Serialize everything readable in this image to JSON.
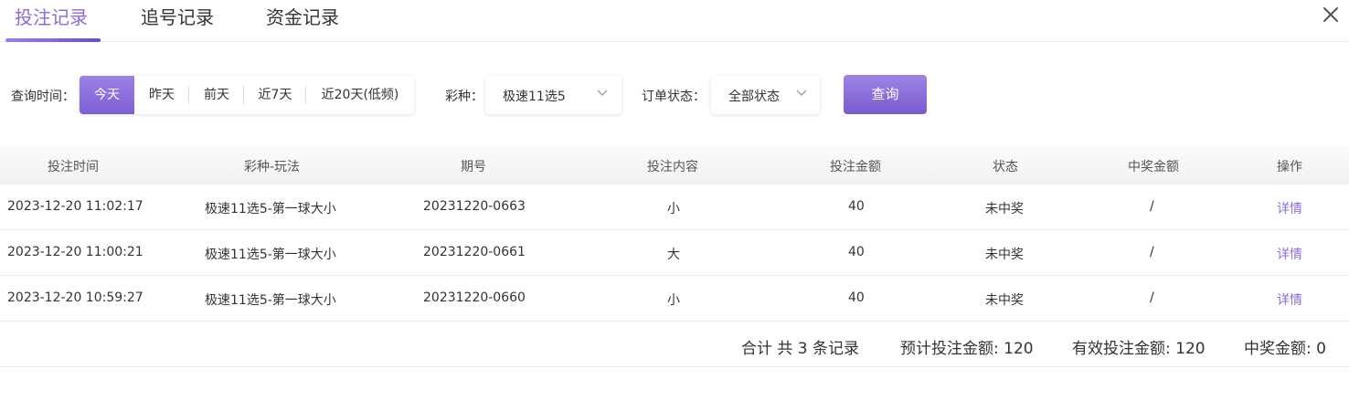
{
  "tabs": [
    {
      "label": "投注记录",
      "active": true
    },
    {
      "label": "追号记录",
      "active": false
    },
    {
      "label": "资金记录",
      "active": false
    }
  ],
  "filters": {
    "time_label": "查询时间：",
    "date_options": [
      "今天",
      "昨天",
      "前天",
      "近7天",
      "近20天(低频)"
    ],
    "date_selected": "今天",
    "lottery_label": "彩种：",
    "lottery_value": "极速11选5",
    "status_label": "订单状态：",
    "status_value": "全部状态",
    "query_button": "查询"
  },
  "table": {
    "headers": [
      "投注时间",
      "彩种-玩法",
      "期号",
      "投注内容",
      "投注金额",
      "状态",
      "中奖金额",
      "操作"
    ],
    "rows": [
      [
        "2023-12-20 11:02:17",
        "极速11选5-第一球大小",
        "20231220-0663",
        "小",
        "40",
        "未中奖",
        "/",
        "详情"
      ],
      [
        "2023-12-20 11:00:21",
        "极速11选5-第一球大小",
        "20231220-0661",
        "大",
        "40",
        "未中奖",
        "/",
        "详情"
      ],
      [
        "2023-12-20 10:59:27",
        "极速11选5-第一球大小",
        "20231220-0660",
        "小",
        "40",
        "未中奖",
        "/",
        "详情"
      ]
    ]
  },
  "summary": {
    "total": "合计 共 3 条记录",
    "expected_bet": "预计投注金额: 120",
    "valid_bet": "有效投注金额: 120",
    "win_amount": "中奖金额: 0"
  },
  "icons": {
    "close": "close-icon",
    "dropdown": "chevron-down-icon"
  },
  "colors": {
    "accent": "#8b6bd9",
    "accent_dark": "#7a5bd0",
    "text": "#333333",
    "border": "#ececec"
  }
}
